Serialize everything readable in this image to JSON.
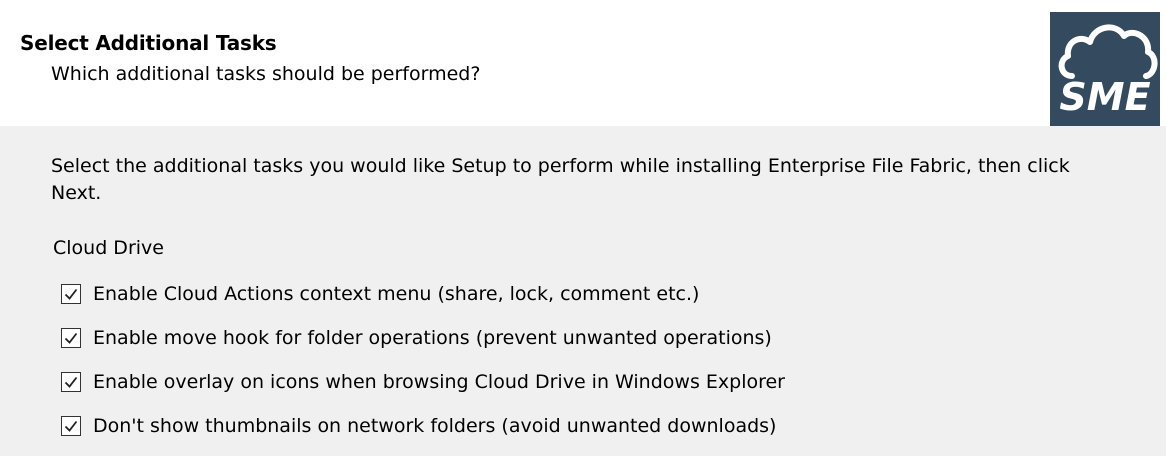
{
  "header": {
    "title": "Select Additional Tasks",
    "subtitle": "Which additional tasks should be performed?",
    "logo_text": "SME",
    "logo_color": "#344a5e"
  },
  "main": {
    "instructions": "Select the additional tasks you would like Setup to perform while installing Enterprise File Fabric, then click Next.",
    "group_label": "Cloud Drive",
    "tasks": [
      {
        "label": "Enable Cloud Actions context menu (share, lock, comment etc.)",
        "checked": true
      },
      {
        "label": "Enable move hook for folder operations (prevent unwanted operations)",
        "checked": true
      },
      {
        "label": "Enable overlay on icons when browsing Cloud Drive in Windows Explorer",
        "checked": true
      },
      {
        "label": "Don't show thumbnails on network folders (avoid unwanted downloads)",
        "checked": true
      }
    ]
  }
}
